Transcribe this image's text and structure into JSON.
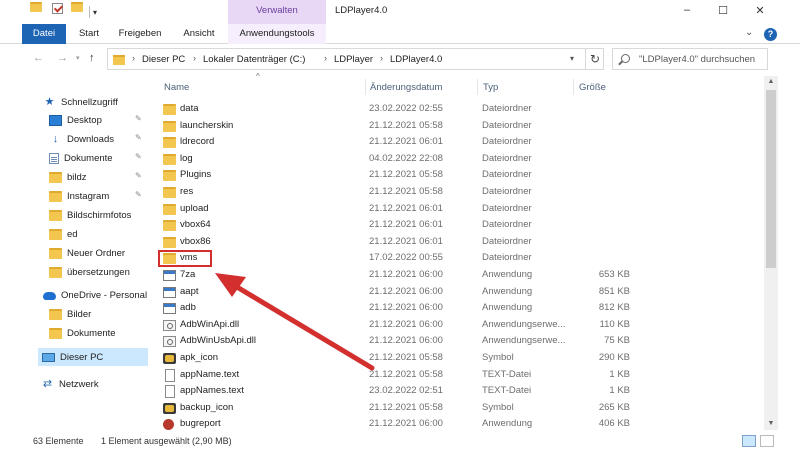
{
  "title_bar": {
    "window_title": "LDPlayer4.0",
    "context_group": "Verwalten",
    "minimize": "–",
    "maximize": "☐",
    "close": "✕"
  },
  "ribbon": {
    "tabs": [
      "Datei",
      "Start",
      "Freigeben",
      "Ansicht",
      "Anwendungstools"
    ],
    "help": "?"
  },
  "address_bar": {
    "crumbs": [
      "Dieser PC",
      "Lokaler Datenträger (C:)",
      "LDPlayer",
      "LDPlayer4.0"
    ],
    "search_placeholder": "\"LDPlayer4.0\" durchsuchen"
  },
  "nav_pane": {
    "items": [
      {
        "label": "Schnellzugriff",
        "icon": "star-icon",
        "pinned": false
      },
      {
        "label": "Desktop",
        "icon": "desktop-icon",
        "pinned": true
      },
      {
        "label": "Downloads",
        "icon": "download-icon",
        "pinned": true
      },
      {
        "label": "Dokumente",
        "icon": "documents-icon",
        "pinned": true
      },
      {
        "label": "bildz",
        "icon": "folder-icon",
        "pinned": true
      },
      {
        "label": "Instagram",
        "icon": "folder-icon",
        "pinned": true
      },
      {
        "label": "Bildschirmfotos",
        "icon": "folder-icon",
        "pinned": false
      },
      {
        "label": "ed",
        "icon": "folder-icon",
        "pinned": false
      },
      {
        "label": "Neuer Ordner",
        "icon": "folder-icon",
        "pinned": false
      },
      {
        "label": "übersetzungen",
        "icon": "folder-icon",
        "pinned": false
      },
      {
        "label": "OneDrive - Personal",
        "icon": "cloud-icon",
        "pinned": false
      },
      {
        "label": "Bilder",
        "icon": "folder-icon",
        "pinned": false
      },
      {
        "label": "Dokumente",
        "icon": "folder-icon",
        "pinned": false
      },
      {
        "label": "Dieser PC",
        "icon": "computer-icon",
        "pinned": false
      },
      {
        "label": "Netzwerk",
        "icon": "network-icon",
        "pinned": false
      }
    ]
  },
  "columns": {
    "name": "Name",
    "date": "Änderungsdatum",
    "type": "Typ",
    "size": "Größe"
  },
  "files": [
    {
      "name": "data",
      "date": "23.02.2022 02:55",
      "type": "Dateiordner",
      "size": "",
      "icon": "folder"
    },
    {
      "name": "launcherskin",
      "date": "21.12.2021 05:58",
      "type": "Dateiordner",
      "size": "",
      "icon": "folder"
    },
    {
      "name": "ldrecord",
      "date": "21.12.2021 06:01",
      "type": "Dateiordner",
      "size": "",
      "icon": "folder"
    },
    {
      "name": "log",
      "date": "04.02.2022 22:08",
      "type": "Dateiordner",
      "size": "",
      "icon": "folder"
    },
    {
      "name": "Plugins",
      "date": "21.12.2021 05:58",
      "type": "Dateiordner",
      "size": "",
      "icon": "folder"
    },
    {
      "name": "res",
      "date": "21.12.2021 05:58",
      "type": "Dateiordner",
      "size": "",
      "icon": "folder"
    },
    {
      "name": "upload",
      "date": "21.12.2021 06:01",
      "type": "Dateiordner",
      "size": "",
      "icon": "folder"
    },
    {
      "name": "vbox64",
      "date": "21.12.2021 06:01",
      "type": "Dateiordner",
      "size": "",
      "icon": "folder"
    },
    {
      "name": "vbox86",
      "date": "21.12.2021 06:01",
      "type": "Dateiordner",
      "size": "",
      "icon": "folder"
    },
    {
      "name": "vms",
      "date": "17.02.2022 00:55",
      "type": "Dateiordner",
      "size": "",
      "icon": "folder"
    },
    {
      "name": "7za",
      "date": "21.12.2021 06:00",
      "type": "Anwendung",
      "size": "653 KB",
      "icon": "exe"
    },
    {
      "name": "aapt",
      "date": "21.12.2021 06:00",
      "type": "Anwendung",
      "size": "851 KB",
      "icon": "exe"
    },
    {
      "name": "adb",
      "date": "21.12.2021 06:00",
      "type": "Anwendung",
      "size": "812 KB",
      "icon": "exe"
    },
    {
      "name": "AdbWinApi.dll",
      "date": "21.12.2021 06:00",
      "type": "Anwendungserwe...",
      "size": "110 KB",
      "icon": "dll"
    },
    {
      "name": "AdbWinUsbApi.dll",
      "date": "21.12.2021 06:00",
      "type": "Anwendungserwe...",
      "size": "75 KB",
      "icon": "dll"
    },
    {
      "name": "apk_icon",
      "date": "21.12.2021 05:58",
      "type": "Symbol",
      "size": "290 KB",
      "icon": "symbol"
    },
    {
      "name": "appName.text",
      "date": "21.12.2021 05:58",
      "type": "TEXT-Datei",
      "size": "1 KB",
      "icon": "text"
    },
    {
      "name": "appNames.text",
      "date": "23.02.2022 02:51",
      "type": "TEXT-Datei",
      "size": "1 KB",
      "icon": "text"
    },
    {
      "name": "backup_icon",
      "date": "21.12.2021 05:58",
      "type": "Symbol",
      "size": "265 KB",
      "icon": "symbol"
    },
    {
      "name": "bugreport",
      "date": "21.12.2021 06:00",
      "type": "Anwendung",
      "size": "406 KB",
      "icon": "bug"
    }
  ],
  "status_bar": {
    "count": "63 Elemente",
    "selection": "1 Element ausgewählt (2,90 MB)"
  },
  "colors": {
    "accent": "#1e64b4",
    "folder": "#f3c74f",
    "annotation": "#d32f2f",
    "manage_group": "#e8d7f5"
  }
}
